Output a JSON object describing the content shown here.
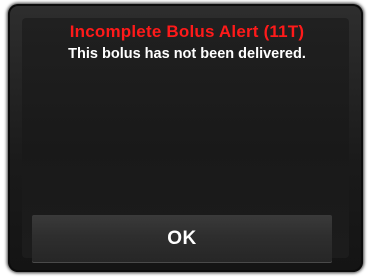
{
  "alert": {
    "title": "Incomplete Bolus Alert (11T)",
    "message": "This bolus has not been delivered.",
    "ok_label": "OK"
  },
  "colors": {
    "title": "#ff1a1a",
    "message": "#ffffff",
    "background": "#1c1c1c",
    "button": "#2e2e2e"
  }
}
